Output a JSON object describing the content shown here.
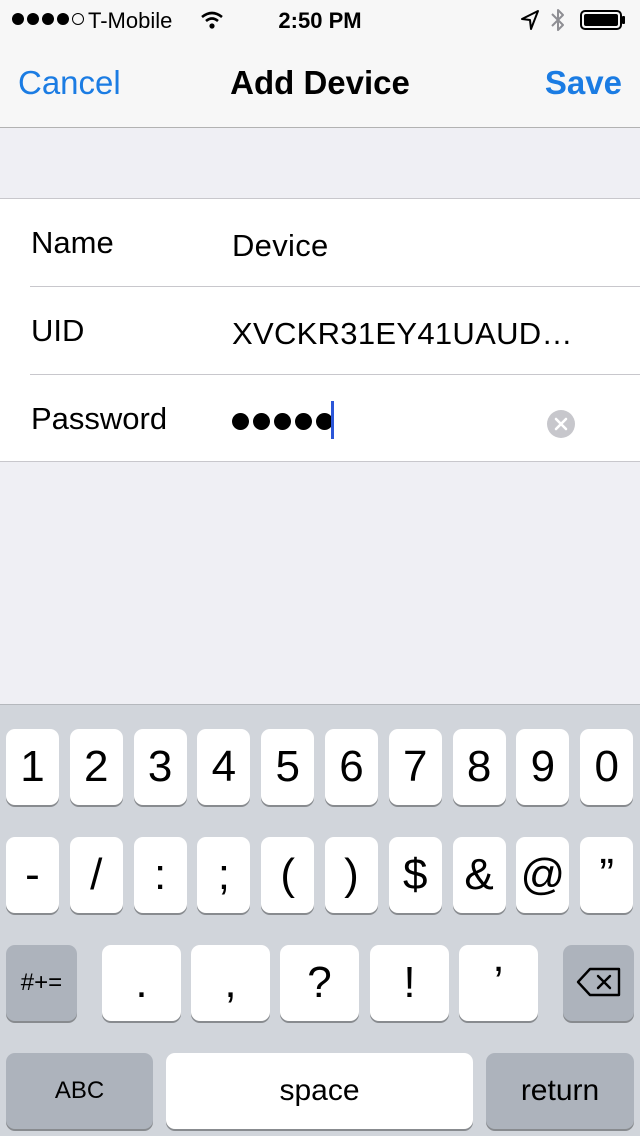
{
  "status_bar": {
    "carrier": "T-Mobile",
    "time": "2:50 PM",
    "signal_bars": 4,
    "signal_total": 5,
    "battery_level": 1.0,
    "icons": [
      "wifi-icon",
      "location-arrow-icon",
      "bluetooth-icon",
      "battery-icon"
    ]
  },
  "nav": {
    "cancel_label": "Cancel",
    "title": "Add Device",
    "save_label": "Save",
    "accent_color": "#1b7ce3"
  },
  "form": {
    "name": {
      "label": "Name",
      "value": "Device"
    },
    "uid": {
      "label": "UID",
      "value": "XVCKR31EY41UAUD…"
    },
    "password": {
      "label": "Password",
      "masked_length": 5
    }
  },
  "keyboard": {
    "row1": [
      "1",
      "2",
      "3",
      "4",
      "5",
      "6",
      "7",
      "8",
      "9",
      "0"
    ],
    "row2": [
      "-",
      "/",
      ":",
      ";",
      "(",
      ")",
      "$",
      "&",
      "@",
      "”"
    ],
    "row3": [
      ".",
      ",",
      "?",
      "!",
      "’"
    ],
    "symbols_toggle": "#+=",
    "abc_toggle": "ABC",
    "space": "space",
    "return": "return"
  }
}
